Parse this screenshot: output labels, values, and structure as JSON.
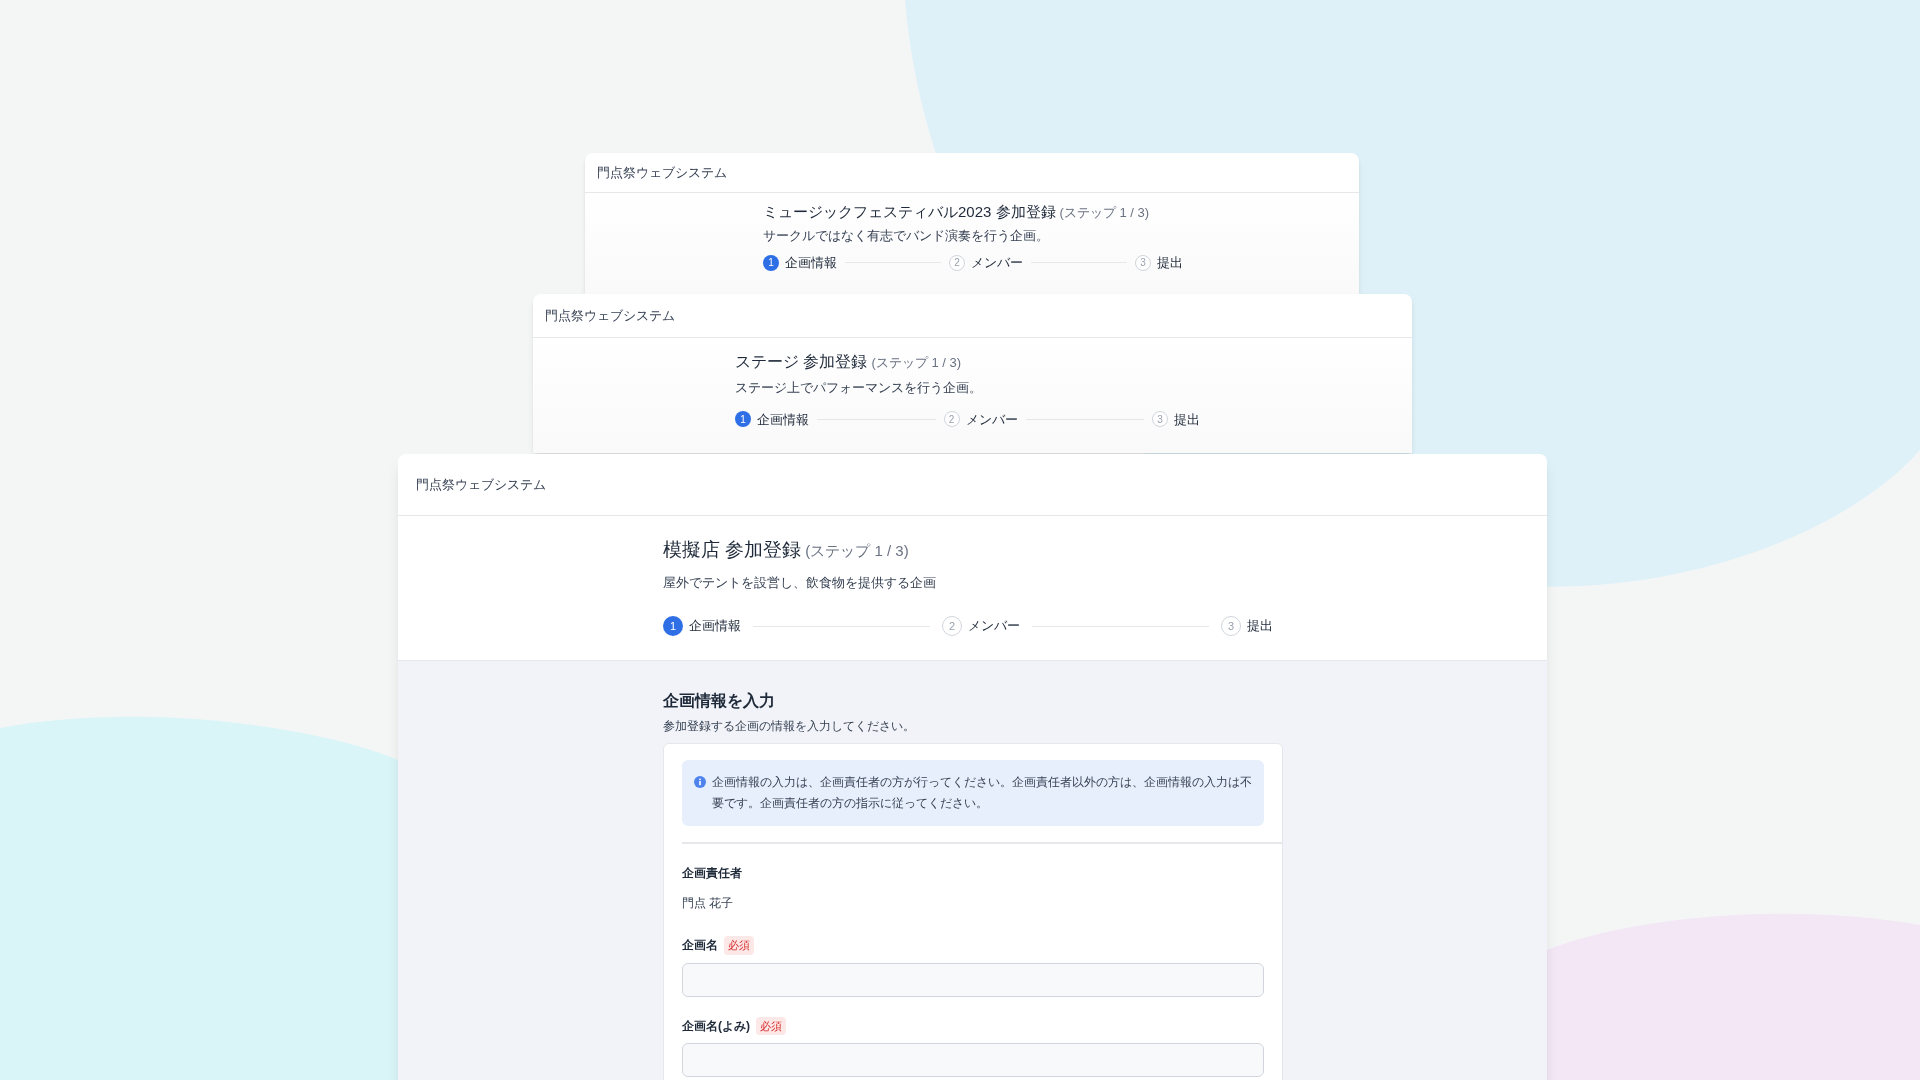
{
  "cards": [
    {
      "app_name": "門点祭ウェブシステム",
      "title": "ミュージックフェスティバル2023 参加登録",
      "step_note": "(ステップ 1 / 3)",
      "description": "サークルではなく有志でバンド演奏を行う企画。",
      "steps": [
        {
          "number": "1",
          "label": "企画情報",
          "selected": true
        },
        {
          "number": "2",
          "label": "メンバー",
          "selected": false
        },
        {
          "number": "3",
          "label": "提出",
          "selected": false
        }
      ]
    },
    {
      "app_name": "門点祭ウェブシステム",
      "title": "ステージ 参加登録",
      "step_note": "(ステップ 1 / 3)",
      "description": "ステージ上でパフォーマンスを行う企画。",
      "steps": [
        {
          "number": "1",
          "label": "企画情報",
          "selected": true
        },
        {
          "number": "2",
          "label": "メンバー",
          "selected": false
        },
        {
          "number": "3",
          "label": "提出",
          "selected": false
        }
      ]
    },
    {
      "app_name": "門点祭ウェブシステム",
      "title": "模擬店 参加登録",
      "step_note": "(ステップ 1 / 3)",
      "description": "屋外でテントを設営し、飲食物を提供する企画",
      "steps": [
        {
          "number": "1",
          "label": "企画情報",
          "selected": true
        },
        {
          "number": "2",
          "label": "メンバー",
          "selected": false
        },
        {
          "number": "3",
          "label": "提出",
          "selected": false
        }
      ],
      "form": {
        "heading": "企画情報を入力",
        "subheading": "参加登録する企画の情報を入力してください。",
        "notice": "企画情報の入力は、企画責任者の方が行ってください。企画責任者以外の方は、企画情報の入力は不要です。企画責任者の方の指示に従ってください。",
        "fields": [
          {
            "kind": "static",
            "label": "企画責任者",
            "value": "門点 花子"
          },
          {
            "kind": "input",
            "label": "企画名",
            "badge": "必須"
          },
          {
            "kind": "input",
            "label": "企画名(よみ)",
            "badge": "必須"
          }
        ]
      }
    }
  ]
}
